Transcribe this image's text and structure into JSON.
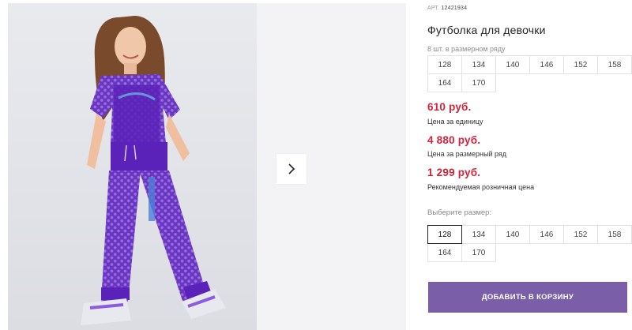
{
  "gallery": {
    "main_image": "girl-purple-mesh-outfit-photo",
    "next_icon": "chevron-right-icon"
  },
  "product": {
    "art_label": "АРТ.",
    "art_value": "12421934",
    "title": "Футболка для девочки",
    "pack_note": "8 шт. в размерном ряду",
    "pack_sizes": [
      "128",
      "134",
      "140",
      "146",
      "152",
      "158",
      "164",
      "170"
    ]
  },
  "prices": [
    {
      "value": "610 руб.",
      "caption": "Цена за единицу"
    },
    {
      "value": "4 880 руб.",
      "caption": "Цена за размерный ряд"
    },
    {
      "value": "1 299 руб.",
      "caption": "Рекомендуемая розничная цена"
    }
  ],
  "size_select": {
    "label": "Выберите размер:",
    "sizes": [
      "128",
      "134",
      "140",
      "146",
      "152",
      "158",
      "164",
      "170"
    ],
    "selected": "128"
  },
  "cart": {
    "add_label": "ДОБАВИТЬ В КОРЗИНУ"
  },
  "colors": {
    "price_red": "#d3233a",
    "button_purple": "#7a5ea8",
    "outfit_purple": "#6a34c4"
  }
}
